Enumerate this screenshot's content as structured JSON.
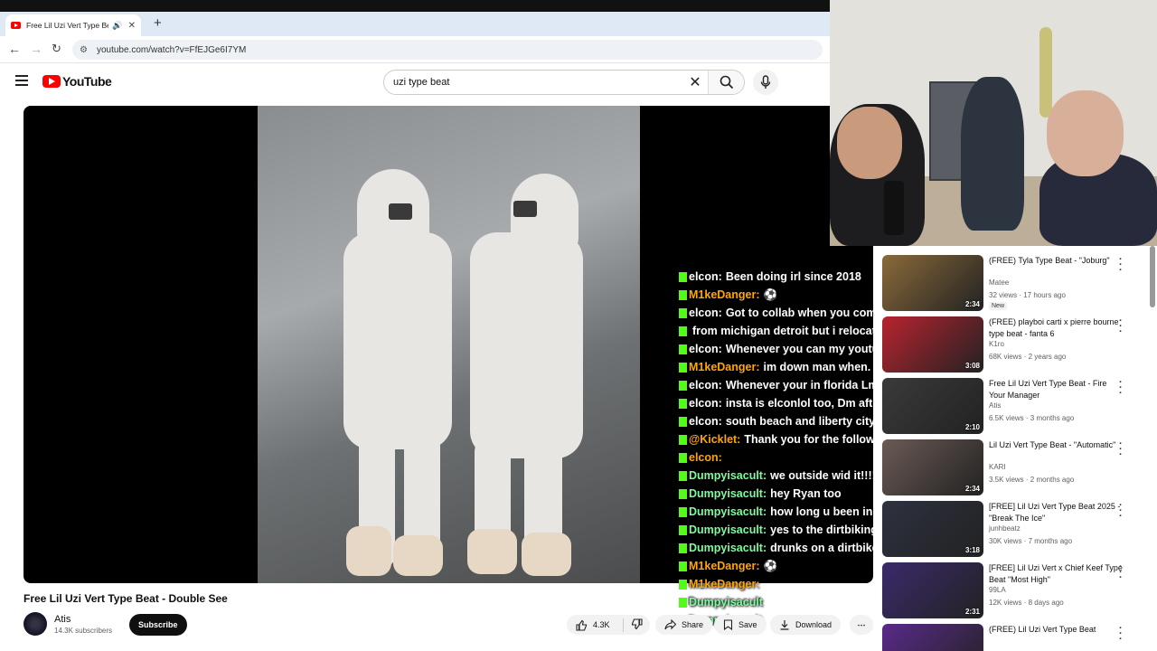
{
  "browser": {
    "tab_title": "Free Lil Uzi Vert Type Beat ·",
    "url": "youtube.com/watch?v=FfEJGe6I7YM"
  },
  "youtube": {
    "logo_text": "YouTube",
    "search_value": "uzi type beat"
  },
  "video": {
    "title": "Free Lil Uzi Vert Type Beat - Double See",
    "channel": "Atis",
    "subscribers": "14.3K subscribers",
    "subscribe_label": "Subscribe",
    "likes": "4.3K",
    "share_label": "Share",
    "save_label": "Save",
    "download_label": "Download"
  },
  "chat": [
    {
      "user": "elcon:",
      "color": "#ffffff",
      "text": "Been doing irl since 2018"
    },
    {
      "user": "M1keDanger:",
      "color": "#ffa500",
      "text": "⚽"
    },
    {
      "user": "elcon:",
      "color": "#ffffff",
      "text": "Got to collab when you come to miami. Street"
    },
    {
      "user": "",
      "color": "#ffffff",
      "text": "from michigan detroit but i relocated to south florida"
    },
    {
      "user": "elcon:",
      "color": "#ffffff",
      "text": "Whenever you can my youtube is @elconlol"
    },
    {
      "user": "M1keDanger:",
      "color": "#ffa500",
      "text": "im down man when. we there"
    },
    {
      "user": "elcon:",
      "color": "#ffffff",
      "text": "Whenever your in florida Lmk"
    },
    {
      "user": "elcon:",
      "color": "#ffffff",
      "text": "insta is elconlol too, Dm after stream"
    },
    {
      "user": "elcon:",
      "color": "#ffffff",
      "text": "south beach and liberty city is loud"
    },
    {
      "user": "@Kicklet:",
      "color": "#ffa500",
      "text": "Thank you for the follow, elcon!"
    },
    {
      "user": "elcon:",
      "color": "#ffa500",
      "text": ""
    },
    {
      "user": "Dumpyisacult:",
      "color": "#7cfc9c",
      "text": "we outside wid it!!!!"
    },
    {
      "user": "Dumpyisacult:",
      "color": "#7cfc9c",
      "text": "hey Ryan too"
    },
    {
      "user": "Dumpyisacult:",
      "color": "#7cfc9c",
      "text": "how long u been in austin"
    },
    {
      "user": "Dumpyisacult:",
      "color": "#7cfc9c",
      "text": "yes to the dirtbiking"
    },
    {
      "user": "Dumpyisacult:",
      "color": "#7cfc9c",
      "text": "drunks on a dirtbike is content"
    },
    {
      "user": "M1keDanger:",
      "color": "#ffa500",
      "text": "⚽"
    },
    {
      "user": "M1keDanger:",
      "color": "#ffa500",
      "text": ""
    },
    {
      "user": "Dumpyisacult",
      "color": "#7cfc9c",
      "text": ""
    },
    {
      "user": "Dumpyisacult",
      "color": "#7cfc9c",
      "text": ""
    }
  ],
  "recommendations": [
    {
      "title": "(FREE) Tyla Type Beat - \"Joburg\"",
      "channel": "Matee",
      "meta": "32 views · 17 hours ago",
      "duration": "2:34",
      "badge": "New",
      "color": "#8a6a3a"
    },
    {
      "title": "(FREE) playboi carti x pierre bourne type beat - fanta 6",
      "channel": "K1ro",
      "meta": "68K views · 2 years ago",
      "duration": "3:08",
      "badge": "",
      "color": "#b8232f"
    },
    {
      "title": "Free Lil Uzi Vert Type Beat - Fire Your Manager",
      "channel": "Atis",
      "meta": "6.5K views · 3 months ago",
      "duration": "2:10",
      "badge": "",
      "color": "#3a3a3a"
    },
    {
      "title": "Lil Uzi Vert Type Beat - \"Automatic\"",
      "channel": "KARI",
      "meta": "3.5K views · 2 months ago",
      "duration": "2:34",
      "badge": "",
      "color": "#6b5a55"
    },
    {
      "title": "[FREE] Lil Uzi Vert Type Beat 2025 - \"Break The Ice\"",
      "channel": "junhbeatz",
      "meta": "30K views · 7 months ago",
      "duration": "3:18",
      "badge": "",
      "color": "#2e3140"
    },
    {
      "title": "[FREE] Lil Uzi Vert x Chief Keef Type Beat \"Most High\"",
      "channel": "99LA",
      "meta": "12K views · 8 days ago",
      "duration": "2:31",
      "badge": "",
      "color": "#3b2a6b"
    },
    {
      "title": "(FREE) Lil Uzi Vert Type Beat",
      "channel": "",
      "meta": "",
      "duration": "",
      "badge": "",
      "color": "#5a2a8a"
    }
  ]
}
